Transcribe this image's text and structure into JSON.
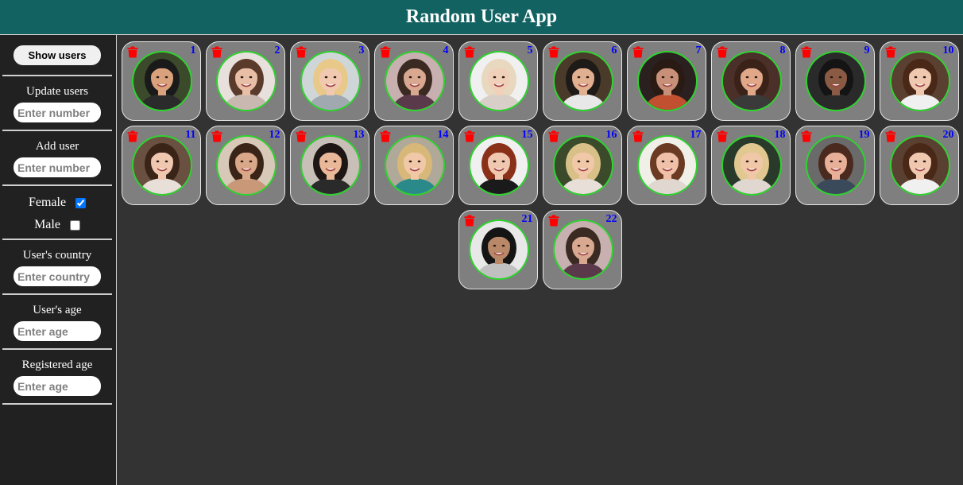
{
  "header": {
    "title": "Random User App"
  },
  "sidebar": {
    "show_button": "Show users",
    "update": {
      "label": "Update users",
      "placeholder": "Enter number"
    },
    "add": {
      "label": "Add user",
      "placeholder": "Enter number"
    },
    "gender": {
      "female_label": "Female",
      "female_checked": true,
      "male_label": "Male",
      "male_checked": false
    },
    "country": {
      "label": "User's country",
      "placeholder": "Enter country"
    },
    "age": {
      "label": "User's age",
      "placeholder": "Enter age"
    },
    "registered": {
      "label": "Registered age",
      "placeholder": "Enter age"
    }
  },
  "colors": {
    "header": "#136262",
    "card": "#7f7f7f",
    "ring": "#2dd42d",
    "trash": "#ff0000",
    "number": "#0000ff"
  },
  "users": [
    {
      "n": "1",
      "bg": "#3a4a2a",
      "hair": "#1a1a1a",
      "skin": "#d9a27c",
      "shirt": "#2b2b2b"
    },
    {
      "n": "2",
      "bg": "#e8e0dc",
      "hair": "#5a3a2a",
      "skin": "#e8bfa6",
      "shirt": "#c8b8b0"
    },
    {
      "n": "3",
      "bg": "#cfd6d8",
      "hair": "#e8c98a",
      "skin": "#f0c9b0",
      "shirt": "#a0a8b0"
    },
    {
      "n": "4",
      "bg": "#c8b0b0",
      "hair": "#3a2a22",
      "skin": "#d8a890",
      "shirt": "#5a3a4a"
    },
    {
      "n": "5",
      "bg": "#f0f0f0",
      "hair": "#e8d8c0",
      "skin": "#f0d0b8",
      "shirt": "#d8d0c8"
    },
    {
      "n": "6",
      "bg": "#4a3a2a",
      "hair": "#1e1a18",
      "skin": "#e0b090",
      "shirt": "#e8e8e8"
    },
    {
      "n": "7",
      "bg": "#2a2020",
      "hair": "#2a1a14",
      "skin": "#c89078",
      "shirt": "#c05030"
    },
    {
      "n": "8",
      "bg": "#4a3028",
      "hair": "#3a2218",
      "skin": "#e0a888",
      "shirt": "#3a3a3a"
    },
    {
      "n": "9",
      "bg": "#2a2a2a",
      "hair": "#141414",
      "skin": "#8a5a44",
      "shirt": "#2a2a2a"
    },
    {
      "n": "10",
      "bg": "#5a4030",
      "hair": "#4a2818",
      "skin": "#f0c8b0",
      "shirt": "#f0f0f0"
    },
    {
      "n": "11",
      "bg": "#6a5040",
      "hair": "#3a2418",
      "skin": "#f0c8b0",
      "shirt": "#e8e0d8"
    },
    {
      "n": "12",
      "bg": "#d8c8b8",
      "hair": "#3a2418",
      "skin": "#d8a888",
      "shirt": "#c89878"
    },
    {
      "n": "13",
      "bg": "#c8c0b8",
      "hair": "#1e1614",
      "skin": "#e8b898",
      "shirt": "#2a2a2a"
    },
    {
      "n": "14",
      "bg": "#b0a898",
      "hair": "#d8b878",
      "skin": "#f0c8a8",
      "shirt": "#2a8a8a"
    },
    {
      "n": "15",
      "bg": "#f0f0f0",
      "hair": "#8a3018",
      "skin": "#f0c8b0",
      "shirt": "#1a1a1a"
    },
    {
      "n": "16",
      "bg": "#3a4a2a",
      "hair": "#d8c088",
      "skin": "#f0c8a8",
      "shirt": "#e8e0d8"
    },
    {
      "n": "17",
      "bg": "#f0f0e8",
      "hair": "#6a3a22",
      "skin": "#f0c0a8",
      "shirt": "#e0d8d0"
    },
    {
      "n": "18",
      "bg": "#2a3a2a",
      "hair": "#e0c890",
      "skin": "#f0c8a8",
      "shirt": "#e0d8d0"
    },
    {
      "n": "19",
      "bg": "#6a6a6a",
      "hair": "#4a2a1e",
      "skin": "#e8b098",
      "shirt": "#3a4a5a"
    },
    {
      "n": "20",
      "bg": "#5a4030",
      "hair": "#4a2818",
      "skin": "#f0c8b0",
      "shirt": "#f0f0f0"
    },
    {
      "n": "21",
      "bg": "#e8e8e8",
      "hair": "#141414",
      "skin": "#b88868",
      "shirt": "#c0c0c0"
    },
    {
      "n": "22",
      "bg": "#c8b0b0",
      "hair": "#3a2a22",
      "skin": "#d8a890",
      "shirt": "#5a3a4a"
    }
  ]
}
